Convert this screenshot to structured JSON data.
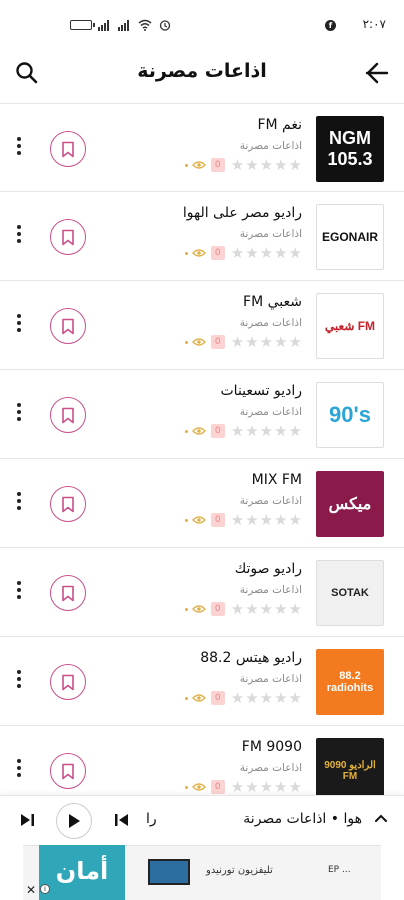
{
  "status_bar": {
    "time": "٢:٠٧"
  },
  "app_bar": {
    "title": "اذاعات مصرنة"
  },
  "stations": [
    {
      "name": "نغم FM",
      "category": "اذاعات مصرنة",
      "logo_text": "NGM 105.3",
      "rank": "0"
    },
    {
      "name": "راديو مصر على الهوا",
      "category": "اذاعات مصرنة",
      "logo_text": "EGONAIR",
      "rank": "0"
    },
    {
      "name": "شعبي FM",
      "category": "اذاعات مصرنة",
      "logo_text": "شعبي FM",
      "rank": "0"
    },
    {
      "name": "راديو تسعينات",
      "category": "اذاعات مصرنة",
      "logo_text": "90's",
      "rank": "0"
    },
    {
      "name": "MIX FM",
      "category": "اذاعات مصرنة",
      "logo_text": "ميكس",
      "rank": "0"
    },
    {
      "name": "راديو صوتك",
      "category": "اذاعات مصرنة",
      "logo_text": "SOTAK",
      "rank": "0"
    },
    {
      "name": "راديو هيتس 88.2",
      "category": "اذاعات مصرنة",
      "logo_text": "88.2 radiohits",
      "rank": "0"
    },
    {
      "name": "9090 FM",
      "category": "اذاعات مصرنة",
      "logo_text": "الراديو 9090 FM",
      "rank": "0"
    }
  ],
  "player": {
    "now_playing": "هوا • اذاعات مصرنة",
    "fragment": "را"
  },
  "ad": {
    "brand": "أمان",
    "text": "تليفزيون تورنيدو",
    "ep": "EP ..."
  },
  "colors": {
    "accent": "#c8508a",
    "divider": "#e6e6e6"
  }
}
